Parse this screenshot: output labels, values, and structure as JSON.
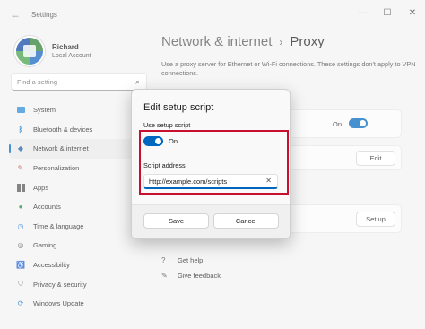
{
  "titlebar": {
    "back_icon": "←",
    "title": "Settings",
    "minimize": "—",
    "maximize": "☐",
    "close": "✕"
  },
  "profile": {
    "name": "Richard",
    "account_type": "Local Account"
  },
  "search": {
    "placeholder": "Find a setting",
    "icon": "⌕"
  },
  "sidebar": {
    "items": [
      {
        "label": "System"
      },
      {
        "label": "Bluetooth & devices",
        "icon": "ᛒ"
      },
      {
        "label": "Network & internet",
        "icon": "◆"
      },
      {
        "label": "Personalization",
        "icon": "✎"
      },
      {
        "label": "Apps"
      },
      {
        "label": "Accounts",
        "icon": "●"
      },
      {
        "label": "Time & language",
        "icon": "◷"
      },
      {
        "label": "Gaming",
        "icon": "◎"
      },
      {
        "label": "Accessibility",
        "icon": "♿"
      },
      {
        "label": "Privacy & security",
        "icon": "⛉"
      },
      {
        "label": "Windows Update",
        "icon": "⟳"
      }
    ]
  },
  "header": {
    "parent": "Network & internet",
    "separator": "›",
    "current": "Proxy"
  },
  "description": "Use a proxy server for Ethernet or Wi-Fi connections. These settings don't apply to VPN connections.",
  "background": {
    "auto_detect_state": "On",
    "edit_button": "Edit",
    "setup_button": "Set up"
  },
  "help": {
    "get_help": "Get help",
    "give_feedback": "Give feedback",
    "help_icon": "?",
    "feedback_icon": "✎"
  },
  "dialog": {
    "title": "Edit setup script",
    "use_setup_script_label": "Use setup script",
    "toggle_state": "On",
    "script_address_label": "Script address",
    "script_address_value": "http://example.com/scripts",
    "clear_icon": "✕",
    "save_button": "Save",
    "cancel_button": "Cancel"
  }
}
